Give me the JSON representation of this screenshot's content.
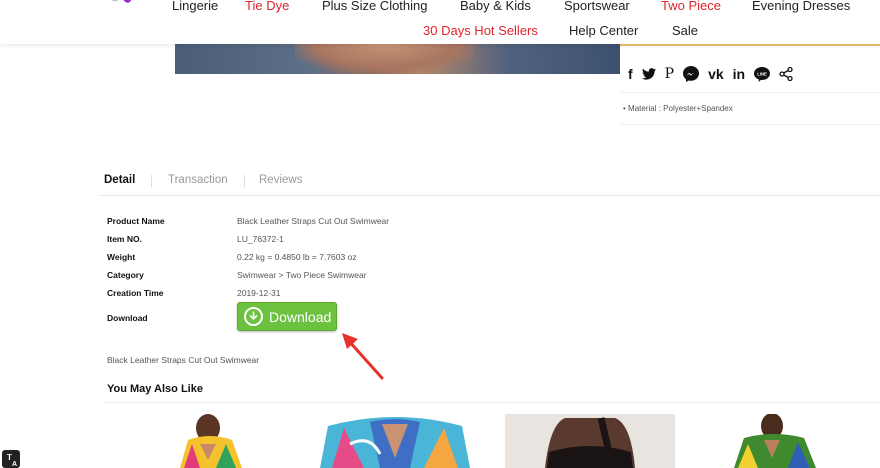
{
  "nav": {
    "row1": [
      {
        "label": "Lingerie",
        "color": "#222222"
      },
      {
        "label": "Tie Dye",
        "color": "#e0242c"
      },
      {
        "label": "Plus Size Clothing",
        "color": "#222222"
      },
      {
        "label": "Baby & Kids",
        "color": "#222222"
      },
      {
        "label": "Sportswear",
        "color": "#222222"
      },
      {
        "label": "Two Piece",
        "color": "#e0242c"
      },
      {
        "label": "Evening Dresses",
        "color": "#222222"
      }
    ],
    "row2": [
      {
        "label": "30 Days Hot Sellers",
        "color": "#e0242c"
      },
      {
        "label": "Help Center",
        "color": "#222222"
      },
      {
        "label": "Sale",
        "color": "#222222"
      }
    ]
  },
  "share": {
    "icons": [
      "facebook-icon",
      "twitter-icon",
      "pinterest-icon",
      "messenger-icon",
      "vk-icon",
      "linkedin-icon",
      "line-icon",
      "share-icon"
    ],
    "labels": {
      "facebook": "f",
      "pinterest": "P",
      "vk": "vk",
      "linkedin": "in",
      "line": "LINE"
    }
  },
  "material": "Material : Polyester+Spandex",
  "tabs": {
    "detail": "Detail",
    "transaction": "Transaction",
    "reviews": "Reviews"
  },
  "details": {
    "product_name_label": "Product Name",
    "product_name": "Black Leather Straps Cut Out Swimwear",
    "item_no_label": "Item NO.",
    "item_no": "LU_76372-1",
    "weight_label": "Weight",
    "weight": "0.22 kg = 0.4850 lb = 7.7603 oz",
    "category_label": "Category",
    "category": "Swimwear > Two Piece Swimwear",
    "creation_time_label": "Creation Time",
    "creation_time": "2019-12-31",
    "download_label": "Download",
    "download_button": "Download"
  },
  "description": "Black Leather Straps Cut Out Swimwear",
  "related_title": "You May Also Like",
  "colors": {
    "accent_red": "#e0242c",
    "download_green": "#6cc23e",
    "arrow_red": "#e8312a"
  }
}
